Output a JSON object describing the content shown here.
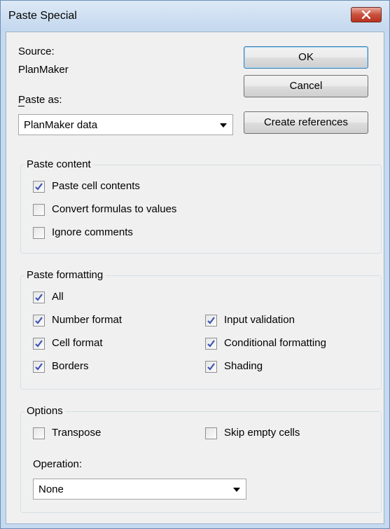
{
  "window": {
    "title": "Paste Special"
  },
  "source": {
    "label": "Source:",
    "value": "PlanMaker"
  },
  "paste_as": {
    "label": "Paste as:",
    "selected": "PlanMaker data"
  },
  "buttons": {
    "ok": "OK",
    "cancel": "Cancel",
    "create_references": "Create references"
  },
  "paste_content": {
    "legend": "Paste content",
    "items": [
      {
        "label": "Paste cell contents",
        "checked": true
      },
      {
        "label": "Convert formulas to values",
        "checked": false
      },
      {
        "label": "Ignore comments",
        "checked": false
      }
    ]
  },
  "paste_formatting": {
    "legend": "Paste formatting",
    "items": [
      {
        "label": "All",
        "checked": true
      },
      {
        "label": "Number format",
        "checked": true
      },
      {
        "label": "Input validation",
        "checked": true
      },
      {
        "label": "Cell format",
        "checked": true
      },
      {
        "label": "Conditional formatting",
        "checked": true
      },
      {
        "label": "Borders",
        "checked": true
      },
      {
        "label": "Shading",
        "checked": true
      }
    ]
  },
  "options": {
    "legend": "Options",
    "items": [
      {
        "label": "Transpose",
        "checked": false
      },
      {
        "label": "Skip empty cells",
        "checked": false
      }
    ],
    "operation_label": "Operation:",
    "operation_selected": "None"
  }
}
